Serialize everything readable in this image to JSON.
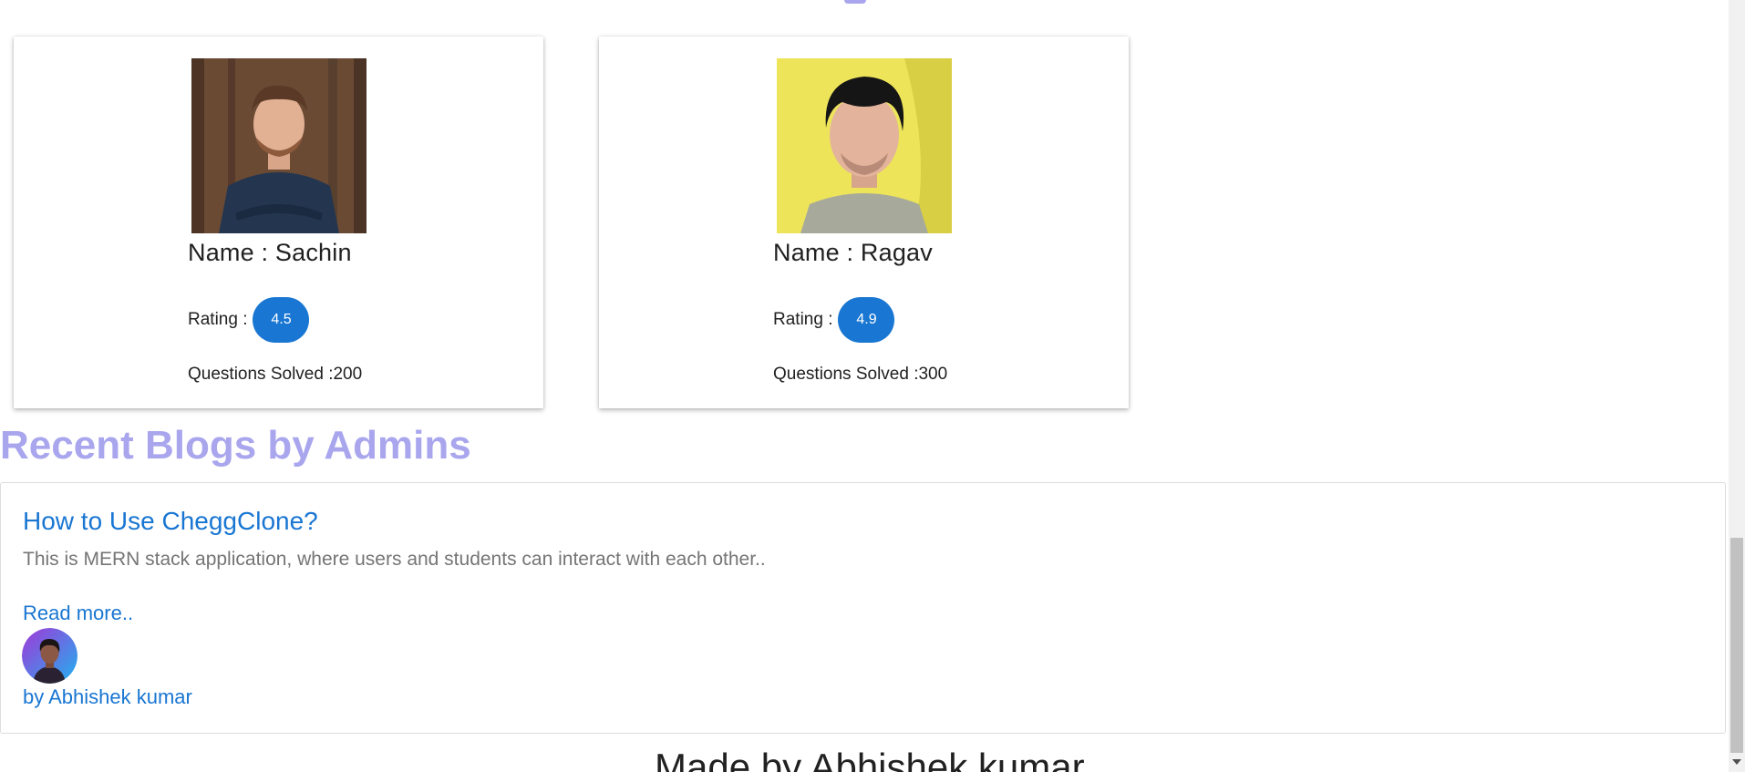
{
  "experts": [
    {
      "photo_icon": "person-photo-icon",
      "name": "Name : Sachin",
      "rating_label": "Rating :",
      "rating": "4.5",
      "questions": "Questions Solved :200"
    },
    {
      "photo_icon": "person-photo-icon",
      "name": "Name : Ragav",
      "rating_label": "Rating :",
      "rating": "4.9",
      "questions": "Questions Solved :300"
    }
  ],
  "blogs_section": {
    "heading": "Recent Blogs by Admins",
    "posts": [
      {
        "title": "How to Use CheggClone?",
        "excerpt": "This is MERN stack application, where users and students can interact with each other..",
        "read_more": "Read more..",
        "author_avatar_icon": "author-avatar-icon",
        "author": "by Abhishek kumar"
      }
    ]
  },
  "footer": {
    "text": "Made by Abhishek kumar"
  },
  "colors": {
    "accent": "#1976d2",
    "heading": "#a9a6ee",
    "muted_text": "#757575"
  }
}
